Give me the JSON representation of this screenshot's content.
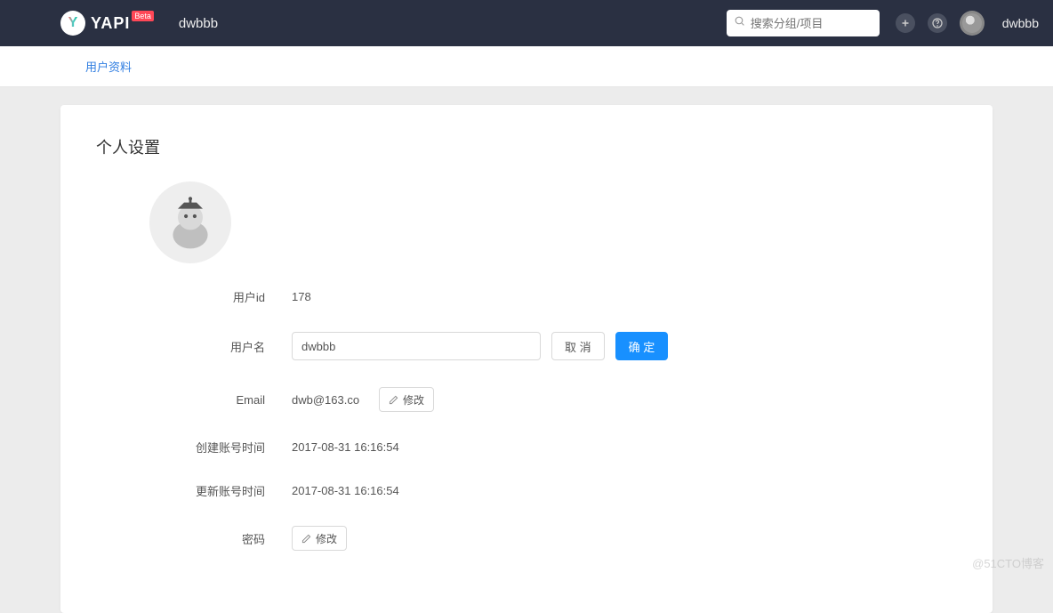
{
  "header": {
    "logo_text": "YAPI",
    "beta": "Beta",
    "project_name": "dwbbb",
    "search_placeholder": "搜索分组/项目",
    "username": "dwbbb"
  },
  "subnav": {
    "profile_tab": "用户资料"
  },
  "card": {
    "title": "个人设置",
    "rows": {
      "user_id_label": "用户id",
      "user_id_value": "178",
      "username_label": "用户名",
      "username_value": "dwbbb",
      "email_label": "Email",
      "email_value": "dwb@163.co",
      "created_label": "创建账号时间",
      "created_value": "2017-08-31 16:16:54",
      "updated_label": "更新账号时间",
      "updated_value": "2017-08-31 16:16:54",
      "password_label": "密码"
    },
    "buttons": {
      "cancel": "取 消",
      "confirm": "确 定",
      "edit": "修改"
    }
  },
  "watermark": "@51CTO博客"
}
